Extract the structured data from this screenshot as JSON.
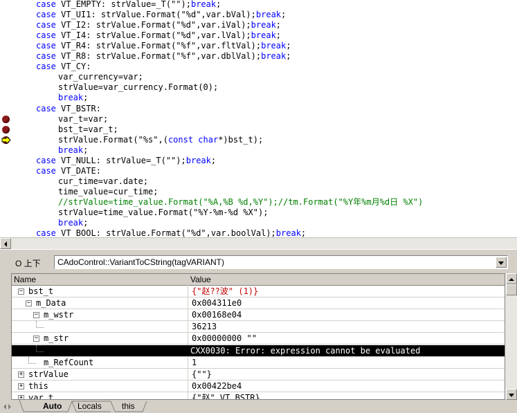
{
  "editor": {
    "lines": [
      {
        "indent": 0,
        "parts": [
          {
            "t": "case ",
            "c": "kw"
          },
          {
            "t": "VT_EMPTY: strValue=_T(\"\");"
          },
          {
            "t": "break",
            "c": "kw"
          },
          {
            "t": ";"
          }
        ]
      },
      {
        "indent": 0,
        "parts": [
          {
            "t": "case ",
            "c": "kw"
          },
          {
            "t": "VT_UI1: strValue.Format(\"%d\",var.bVal);"
          },
          {
            "t": "break",
            "c": "kw"
          },
          {
            "t": ";"
          }
        ]
      },
      {
        "indent": 0,
        "parts": [
          {
            "t": "case ",
            "c": "kw"
          },
          {
            "t": "VT_I2: strValue.Format(\"%d\",var.iVal);"
          },
          {
            "t": "break",
            "c": "kw"
          },
          {
            "t": ";"
          }
        ]
      },
      {
        "indent": 0,
        "parts": [
          {
            "t": "case ",
            "c": "kw"
          },
          {
            "t": "VT_I4: strValue.Format(\"%d\",var.lVal);"
          },
          {
            "t": "break",
            "c": "kw"
          },
          {
            "t": ";"
          }
        ]
      },
      {
        "indent": 0,
        "parts": [
          {
            "t": "case ",
            "c": "kw"
          },
          {
            "t": "VT_R4: strValue.Format(\"%f\",var.fltVal);"
          },
          {
            "t": "break",
            "c": "kw"
          },
          {
            "t": ";"
          }
        ]
      },
      {
        "indent": 0,
        "parts": [
          {
            "t": "case ",
            "c": "kw"
          },
          {
            "t": "VT_R8: strValue.Format(\"%f\",var.dblVal);"
          },
          {
            "t": "break",
            "c": "kw"
          },
          {
            "t": ";"
          }
        ]
      },
      {
        "indent": 0,
        "parts": [
          {
            "t": "case ",
            "c": "kw"
          },
          {
            "t": "VT_CY:"
          }
        ]
      },
      {
        "indent": 1,
        "parts": [
          {
            "t": "var_currency=var;"
          }
        ]
      },
      {
        "indent": 1,
        "parts": [
          {
            "t": "strValue=var_currency.Format(0);"
          }
        ]
      },
      {
        "indent": 1,
        "parts": [
          {
            "t": "break",
            "c": "kw"
          },
          {
            "t": ";"
          }
        ]
      },
      {
        "indent": 0,
        "parts": [
          {
            "t": "case ",
            "c": "kw"
          },
          {
            "t": "VT_BSTR:"
          }
        ]
      },
      {
        "indent": 1,
        "parts": [
          {
            "t": "var_t=var;"
          }
        ],
        "marker": "breakpoint"
      },
      {
        "indent": 1,
        "parts": [
          {
            "t": "bst_t=var_t;"
          }
        ],
        "marker": "breakpoint"
      },
      {
        "indent": 1,
        "parts": [
          {
            "t": "strValue.Format(\"%s\",("
          },
          {
            "t": "const char",
            "c": "kw"
          },
          {
            "t": "*)bst_t);"
          }
        ],
        "marker": "current"
      },
      {
        "indent": 1,
        "parts": [
          {
            "t": "break",
            "c": "kw"
          },
          {
            "t": ";"
          }
        ]
      },
      {
        "indent": 0,
        "parts": [
          {
            "t": "case ",
            "c": "kw"
          },
          {
            "t": "VT_NULL: strValue=_T(\"\");"
          },
          {
            "t": "break",
            "c": "kw"
          },
          {
            "t": ";"
          }
        ]
      },
      {
        "indent": 0,
        "parts": [
          {
            "t": "case ",
            "c": "kw"
          },
          {
            "t": "VT_DATE:"
          }
        ]
      },
      {
        "indent": 1,
        "parts": [
          {
            "t": "cur_time=var.date;"
          }
        ]
      },
      {
        "indent": 1,
        "parts": [
          {
            "t": "time_value=cur_time;"
          }
        ]
      },
      {
        "indent": 1,
        "parts": [
          {
            "t": "//strValue=time_value.Format(\"%A,%B %d,%Y\");//tm.Format(\"%Y年%m月%d日 %X\")",
            "c": "cm"
          }
        ]
      },
      {
        "indent": 1,
        "parts": [
          {
            "t": "strValue=time_value.Format(\"%Y-%m-%d %X\");"
          }
        ]
      },
      {
        "indent": 1,
        "parts": [
          {
            "t": "break",
            "c": "kw"
          },
          {
            "t": ";"
          }
        ]
      },
      {
        "indent": 0,
        "parts": [
          {
            "t": "case ",
            "c": "kw"
          },
          {
            "t": "VT_BOOL: strValue.Format(\"%d\",var.boolVal);"
          },
          {
            "t": "break",
            "c": "kw"
          },
          {
            "t": ";"
          }
        ]
      }
    ]
  },
  "context": {
    "label": "O 上下",
    "value": "CAdoControl::VariantToCString(tagVARIANT)"
  },
  "watch": {
    "col_name": "Name",
    "col_value": "Value",
    "rows": [
      {
        "name": "bst_t",
        "value": "{\"赵??波\" (1)}",
        "level": 0,
        "exp": "minus",
        "valcolor": "#c00000"
      },
      {
        "name": "m_Data",
        "value": "0x004311e0",
        "level": 1,
        "exp": "minus"
      },
      {
        "name": "m_wstr",
        "value": "0x00168e04",
        "level": 2,
        "exp": "minus"
      },
      {
        "name": "",
        "value": "36213",
        "level": 3,
        "exp": "none"
      },
      {
        "name": "m_str",
        "value": "0x00000000 \"\"",
        "level": 2,
        "exp": "minus"
      },
      {
        "name": "",
        "value": "CXX0030: Error: expression cannot be evaluated",
        "level": 3,
        "exp": "none",
        "selected": true
      },
      {
        "name": "m_RefCount",
        "value": "1",
        "level": 2,
        "exp": "none"
      },
      {
        "name": "strValue",
        "value": "{\"\"}",
        "level": 0,
        "exp": "plus"
      },
      {
        "name": "this",
        "value": "0x00422be4",
        "level": 0,
        "exp": "plus"
      },
      {
        "name": "var_t",
        "value": "{\"赵\" VT_BSTR}",
        "level": 0,
        "exp": "plus"
      }
    ]
  },
  "tabs": [
    {
      "label": "Auto",
      "active": true
    },
    {
      "label": "Locals",
      "active": false
    },
    {
      "label": "this",
      "active": false
    }
  ],
  "icons": {
    "breakpoint": "breakpoint-icon",
    "current": "current-line-arrow-icon",
    "expand": "tree-expander-icon"
  }
}
